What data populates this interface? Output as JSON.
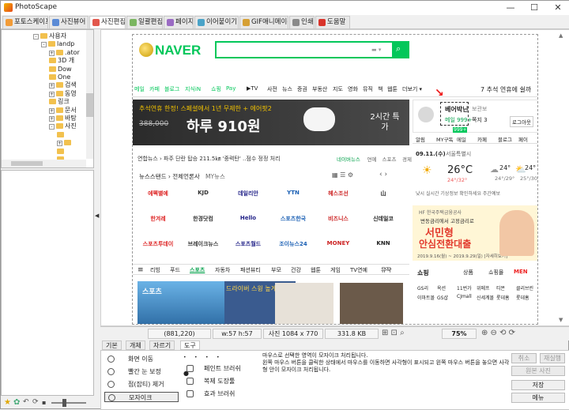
{
  "window": {
    "title": "PhotoScape",
    "min": "—",
    "max": "☐",
    "close": "✕"
  },
  "tabs": [
    {
      "label": "포토스케이프",
      "color": "#f29c38"
    },
    {
      "label": "사진뷰어",
      "color": "#5b8bd6"
    },
    {
      "label": "사진편집",
      "color": "#e2574c"
    },
    {
      "label": "일괄편집",
      "color": "#7bb661"
    },
    {
      "label": "페이지",
      "color": "#9b6bc4"
    },
    {
      "label": "이어붙이기",
      "color": "#4aa3c8"
    },
    {
      "label": "GIF애니메이션",
      "color": "#d6a035"
    },
    {
      "label": "인쇄",
      "color": "#8a8a8a"
    },
    {
      "label": "도움말",
      "color": "#d9342b"
    }
  ],
  "tree": {
    "items": [
      {
        "label": "사용자",
        "indent": 0,
        "exp": "-"
      },
      {
        "label": "landp",
        "indent": 1,
        "exp": "-"
      },
      {
        "label": ".ator",
        "indent": 2,
        "exp": "+"
      },
      {
        "label": "3D 개",
        "indent": 2,
        "exp": ""
      },
      {
        "label": "Dow",
        "indent": 2,
        "exp": ""
      },
      {
        "label": "One",
        "indent": 2,
        "exp": ""
      },
      {
        "label": "검색",
        "indent": 2,
        "exp": "+"
      },
      {
        "label": "동영",
        "indent": 2,
        "exp": "+"
      },
      {
        "label": "링크",
        "indent": 2,
        "exp": ""
      },
      {
        "label": "문서",
        "indent": 2,
        "exp": "+"
      },
      {
        "label": "바탕",
        "indent": 2,
        "exp": "+"
      },
      {
        "label": "사진",
        "indent": 2,
        "exp": "-"
      },
      {
        "label": "",
        "indent": 3,
        "exp": ""
      },
      {
        "label": "",
        "indent": 3,
        "exp": "+"
      },
      {
        "label": "",
        "indent": 3,
        "exp": ""
      },
      {
        "label": "",
        "indent": 3,
        "exp": ""
      }
    ]
  },
  "naver": {
    "logo": "NAVER",
    "menu": [
      "메일",
      "카페",
      "블로그",
      "지식iN",
      "쇼핑",
      "Pay",
      "▶TV",
      "사전",
      "뉴스",
      "증권",
      "부동산",
      "지도",
      "영화",
      "뮤직",
      "책",
      "웹툰",
      "더보기 ▾"
    ],
    "weather_top": "7  추석 연휴에 쉴까",
    "banner_text": "추석연휴 한정! 스페셜에서 1년 무제한 + 에어팟2",
    "banner_price_old": "388,000",
    "banner_price": "하루 910원",
    "banner_tag": "2시간 특가",
    "news_ticker": "연합뉴스 › 파주 단란 탑승 211.5㎞ '중력탄' ..점수 정정 처리",
    "news_links": [
      "네이버뉴스",
      "연예",
      "스포츠",
      "경제"
    ],
    "newsstand": "뉴스스탠드 › 전체언론사",
    "my_news": "MY뉴스",
    "press": [
      [
        "에펙별예",
        "KJD",
        "데일리안",
        "YTN",
        "헤스조선",
        "山"
      ],
      [
        "한겨레",
        "한경닷컴",
        "Hello",
        "스포츠한국",
        "비즈니스",
        "신데일코"
      ],
      [
        "스포츠투데이",
        "브레이크뉴스",
        "스포츠월드",
        "조이뉴스24",
        "MONEY",
        "KNN"
      ]
    ],
    "categories": [
      "리빙",
      "푸드",
      "스포츠",
      "자동차",
      "패션뷰티",
      "부모",
      "건강",
      "웹툰",
      "게임",
      "TV연예",
      "뮤직"
    ],
    "sports_label": "스포츠",
    "sports_caption": "드라이버 스윙 높게? 낮게?",
    "login": {
      "user": "베어박닌",
      "logout_link": "보관보",
      "mail": "메일 999+",
      "note": "쪽지 3",
      "logout_btn": "로그아웃",
      "badge": "999+"
    },
    "login_tabs": [
      "알림",
      "MY구독",
      "메일",
      "카페",
      "블로그",
      "페이"
    ],
    "weather": {
      "date": "09.11.(수)",
      "location": "서울특별시",
      "temp": "26°C",
      "minmax": "24°/32°",
      "t2": "24°",
      "t2mm": "24°/29°",
      "t3": "24°",
      "t3mm": "25°/30°",
      "note": "낮시 실시간 기상정보 확인하세요  주간예보"
    },
    "ad": {
      "top": "HF 한국주택금융공사",
      "line1": "변동금리에서 고정금리로",
      "line2": "서민형",
      "line3": "안심전환대출",
      "foot": "2019.9.16(월) ~ 2019.9.29(일)  [자세히보기]"
    },
    "shopping": {
      "title": "쇼핑",
      "tabs": [
        "상품",
        "쇼핑몰",
        "MEN"
      ],
      "row1": [
        "GS리",
        "옥션",
        "11번가",
        "위메프",
        "티몬",
        "클리브린"
      ],
      "row2": [
        "이마트몰",
        "GS샵",
        "CJmall",
        "신세계몰",
        "롯데홈",
        "롯데홈"
      ]
    }
  },
  "status": {
    "coords": "(881,220)",
    "sel": "w:57 h:57",
    "size": "사진 1084 x 770",
    "filesize": "331.8 KB",
    "zoom": "75%"
  },
  "bottom_tabs": [
    "기본",
    "개체",
    "자르기",
    "도구"
  ],
  "tools": {
    "col1": [
      "화면 이동",
      "빨간 눈 보정",
      "점(잡티) 제거",
      "모자이크"
    ],
    "col2": [
      "페인트 브러쉬",
      "복제 도장툴",
      "효과 브러쉬"
    ],
    "help": "마우스로 선택한 영역이 모자이크 처리됩니다.\n왼쪽 마우스 버튼을 클릭한 상태에서 마우스를 이동하면 사각형이 표시되고 왼쪽 마우스 버튼을 놓으면 사각형 안이 모자이크 처리됩니다."
  },
  "right_buttons": [
    "취소",
    "재실행",
    "원본 사진",
    "저장",
    "메뉴"
  ]
}
